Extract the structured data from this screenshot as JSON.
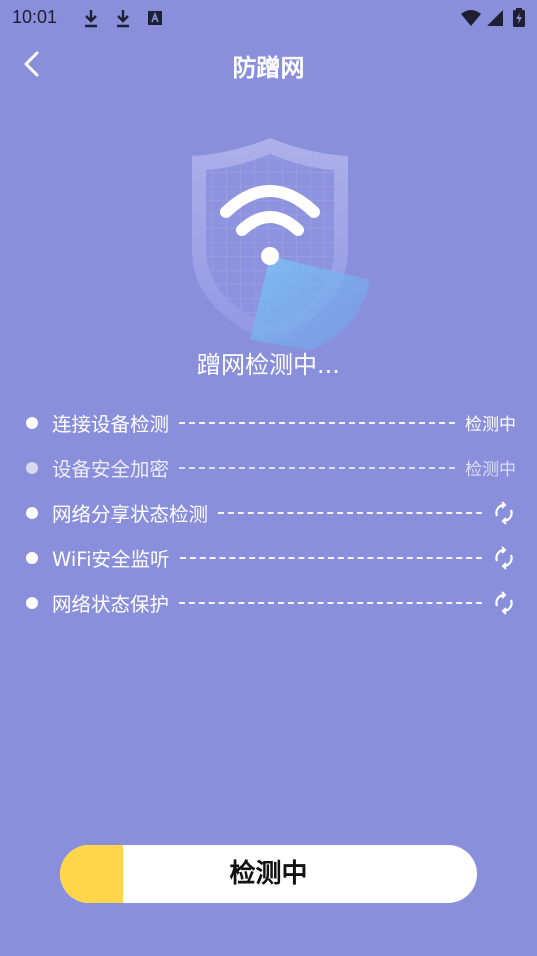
{
  "status_bar": {
    "time": "10:01",
    "icons": [
      "download-icon",
      "download-icon",
      "a-icon",
      "wifi-icon",
      "signal-icon",
      "battery-icon"
    ]
  },
  "header": {
    "title": "防蹭网",
    "back_icon": "chevron-left-icon"
  },
  "scan": {
    "title": "蹭网检测中...",
    "items": [
      {
        "label": "连接设备检测",
        "status": "检测中",
        "state": "text"
      },
      {
        "label": "设备安全加密",
        "status": "检测中",
        "state": "text-fading"
      },
      {
        "label": "网络分享状态检测",
        "status": "",
        "state": "spinner"
      },
      {
        "label": "WiFi安全监听",
        "status": "",
        "state": "spinner"
      },
      {
        "label": "网络状态保护",
        "status": "",
        "state": "spinner"
      }
    ]
  },
  "button": {
    "label": "检测中",
    "progress": 0.15,
    "fill_color": "#ffd54a"
  },
  "colors": {
    "background": "#8a8fdc",
    "text": "#ffffff"
  }
}
